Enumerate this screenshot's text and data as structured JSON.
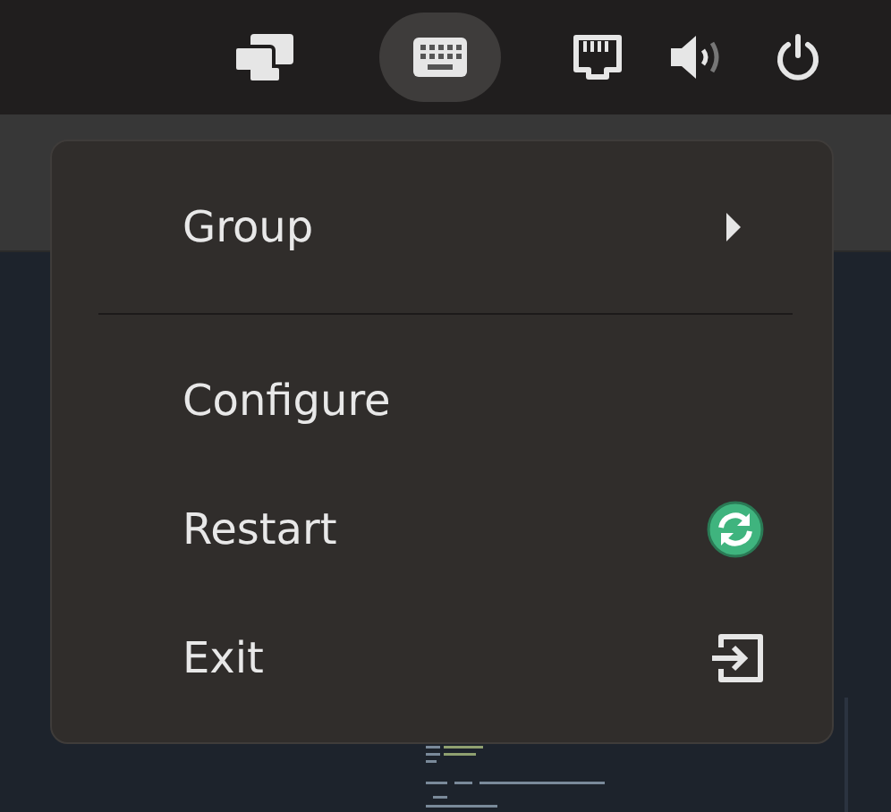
{
  "tray": [
    {
      "kind": "displays",
      "selected": false
    },
    {
      "kind": "keyboard",
      "selected": true
    },
    {
      "kind": "network",
      "selected": false
    },
    {
      "kind": "volume",
      "selected": false
    },
    {
      "kind": "power",
      "selected": false
    }
  ],
  "menu": [
    {
      "kind": "submenu",
      "label": "Group"
    },
    {
      "kind": "separator"
    },
    {
      "kind": "plain",
      "label": "Configure"
    },
    {
      "kind": "restart",
      "label": "Restart"
    },
    {
      "kind": "exit",
      "label": "Exit"
    }
  ]
}
